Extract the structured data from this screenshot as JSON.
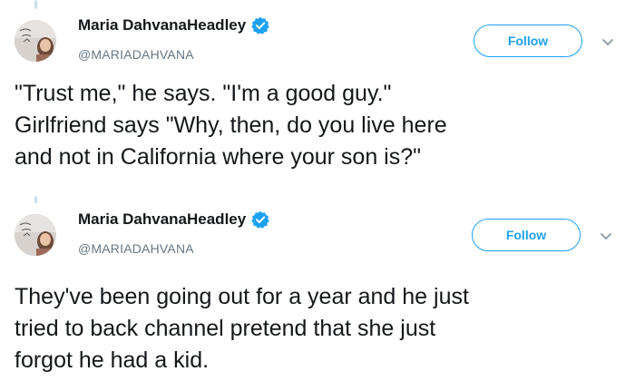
{
  "tweets": [
    {
      "display_name": "Maria DahvanaHeadley",
      "handle": "@MARIADAHVANA",
      "follow_label": "Follow",
      "text": "\"Trust me,\" he says. \"I'm a good guy.\"\nGirlfriend says \"Why, then, do you live here\nand not in California where your son is?\"",
      "verified": true,
      "avatar_icon": "avatar-photo",
      "menu_icon": "chevron-down-icon"
    },
    {
      "display_name": "Maria DahvanaHeadley",
      "handle": "@MARIADAHVANA",
      "follow_label": "Follow",
      "text": "They've been going out for a year and he just\ntried to back channel pretend that she just\nforgot he had a kid.",
      "verified": true,
      "avatar_icon": "avatar-photo",
      "menu_icon": "chevron-down-icon"
    }
  ],
  "colors": {
    "accent": "#1da1f2",
    "text": "#14171a",
    "secondary_text": "#657786",
    "thread_line": "#c9dfe9"
  }
}
